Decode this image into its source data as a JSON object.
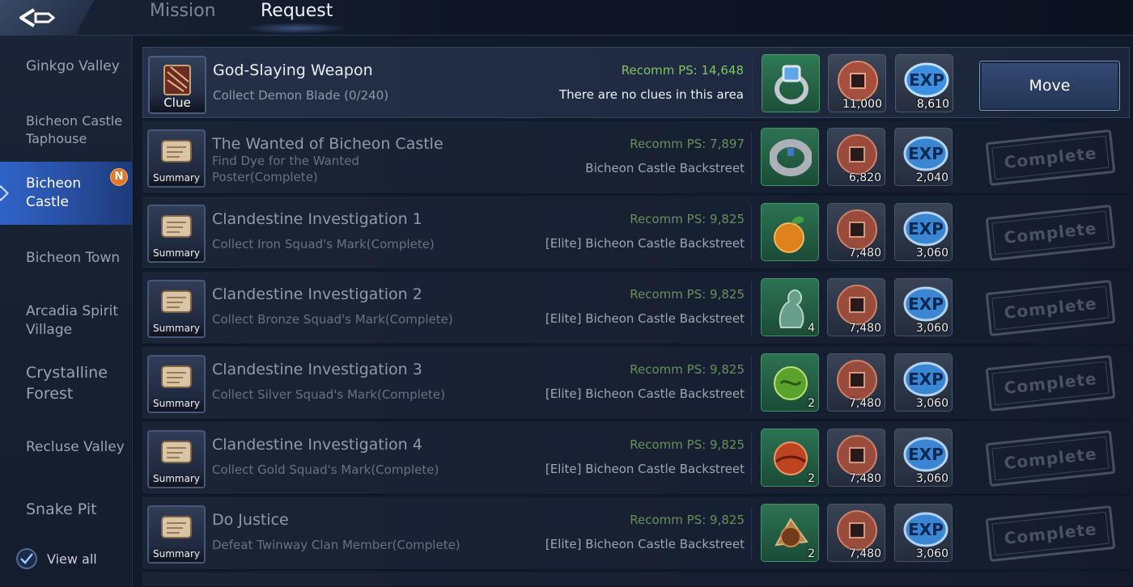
{
  "header": {
    "back_icon": "back-arrow-icon",
    "tabs": [
      {
        "label": "Mission",
        "active": false
      },
      {
        "label": "Request",
        "active": true
      }
    ]
  },
  "sidebar": {
    "items": [
      {
        "label": "Ginkgo Valley",
        "active": false
      },
      {
        "label": "Bicheon Castle Taphouse",
        "active": false
      },
      {
        "label": "Bicheon Castle",
        "active": true,
        "badge": "N"
      },
      {
        "label": "Bicheon Town",
        "active": false
      },
      {
        "label": "Arcadia Spirit Village",
        "active": false
      },
      {
        "label": "Crystalline Forest",
        "active": false
      },
      {
        "label": "Recluse Valley",
        "active": false
      },
      {
        "label": "Snake Pit",
        "active": false
      }
    ],
    "view_all_label": "View all",
    "view_all_checked": true
  },
  "quests": [
    {
      "icon": "clue-scroll-icon",
      "icon_label": "Clue",
      "title": "God-Slaying Weapon",
      "desc": "Collect Demon Blade (0/240)",
      "ps": "Recomm PS: 14,648",
      "location": "There are no clues in this area",
      "rewards": [
        {
          "icon": "ring-icon",
          "count": ""
        },
        {
          "icon": "coin-icon",
          "count": "11,000"
        },
        {
          "icon": "exp-icon",
          "count": "8,610"
        }
      ],
      "action": "Move"
    },
    {
      "icon": "summary-scroll-icon",
      "icon_label": "Summary",
      "title": "The Wanted of Bicheon Castle",
      "desc": "Find Dye for the Wanted Poster(Complete)",
      "ps": "Recomm PS: 7,897",
      "location": "Bicheon Castle Backstreet",
      "rewards": [
        {
          "icon": "bracelet-icon",
          "count": ""
        },
        {
          "icon": "coin-icon",
          "count": "6,820"
        },
        {
          "icon": "exp-icon",
          "count": "2,040"
        }
      ],
      "action": "Complete"
    },
    {
      "icon": "summary-scroll-icon",
      "icon_label": "Summary",
      "title": "Clandestine Investigation 1",
      "desc": "Collect Iron Squad's Mark(Complete)",
      "ps": "Recomm PS: 9,825",
      "location": "[Elite] Bicheon Castle Backstreet",
      "rewards": [
        {
          "icon": "orange-fruit-icon",
          "count": ""
        },
        {
          "icon": "coin-icon",
          "count": "7,480"
        },
        {
          "icon": "exp-icon",
          "count": "3,060"
        }
      ],
      "action": "Complete"
    },
    {
      "icon": "summary-scroll-icon",
      "icon_label": "Summary",
      "title": "Clandestine Investigation 2",
      "desc": "Collect Bronze Squad's Mark(Complete)",
      "ps": "Recomm PS: 9,825",
      "location": "[Elite] Bicheon Castle Backstreet",
      "rewards": [
        {
          "icon": "jade-statue-icon",
          "count": "4"
        },
        {
          "icon": "coin-icon",
          "count": "7,480"
        },
        {
          "icon": "exp-icon",
          "count": "3,060"
        }
      ],
      "action": "Complete"
    },
    {
      "icon": "summary-scroll-icon",
      "icon_label": "Summary",
      "title": "Clandestine Investigation 3",
      "desc": "Collect Silver Squad's Mark(Complete)",
      "ps": "Recomm PS: 9,825",
      "location": "[Elite] Bicheon Castle Backstreet",
      "rewards": [
        {
          "icon": "green-orb-icon",
          "count": "2"
        },
        {
          "icon": "coin-icon",
          "count": "7,480"
        },
        {
          "icon": "exp-icon",
          "count": "3,060"
        }
      ],
      "action": "Complete"
    },
    {
      "icon": "summary-scroll-icon",
      "icon_label": "Summary",
      "title": "Clandestine Investigation 4",
      "desc": "Collect Gold Squad's Mark(Complete)",
      "ps": "Recomm PS: 9,825",
      "location": "[Elite] Bicheon Castle Backstreet",
      "rewards": [
        {
          "icon": "red-orb-icon",
          "count": "2"
        },
        {
          "icon": "coin-icon",
          "count": "7,480"
        },
        {
          "icon": "exp-icon",
          "count": "3,060"
        }
      ],
      "action": "Complete"
    },
    {
      "icon": "summary-scroll-icon",
      "icon_label": "Summary",
      "title": "Do Justice",
      "desc": "Defeat Twinway Clan Member(Complete)",
      "ps": "Recomm PS: 9,825",
      "location": "[Elite] Bicheon Castle Backstreet",
      "rewards": [
        {
          "icon": "brown-orb-icon",
          "count": "2"
        },
        {
          "icon": "coin-icon",
          "count": "7,480"
        },
        {
          "icon": "exp-icon",
          "count": "3,060"
        }
      ],
      "action": "Complete"
    }
  ],
  "colors": {
    "accent": "#2f63c8",
    "ps_green": "#7fc466",
    "badge_orange": "#e07a2a",
    "item_green": "#2f7a55"
  }
}
